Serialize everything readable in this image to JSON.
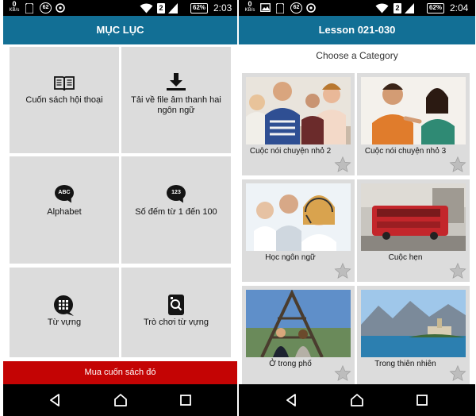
{
  "left": {
    "status": {
      "kb_value": "0",
      "kb_unit": "KB/s",
      "notif_count": "62",
      "sim": "2",
      "battery": "62%",
      "time": "2:03"
    },
    "title": "MỤC LỤC",
    "menu": [
      {
        "label": "Cuốn sách hội thoại",
        "icon": "book-icon"
      },
      {
        "label": "Tải về file âm thanh hai ngôn ngữ",
        "icon": "download-icon"
      },
      {
        "label": "Alphabet",
        "icon": "abc-bubble-icon",
        "icon_text": "ABC"
      },
      {
        "label": "Số đếm từ 1 đến 100",
        "icon": "numbers-bubble-icon",
        "icon_text": "123"
      },
      {
        "label": "Từ vựng",
        "icon": "vocabulary-grid-icon"
      },
      {
        "label": "Trò chơi từ vựng",
        "icon": "game-card-icon"
      }
    ],
    "buy_label": "Mua cuốn sách đó"
  },
  "right": {
    "status": {
      "kb_value": "0",
      "kb_unit": "KB/s",
      "notif_count": "62",
      "sim": "2",
      "battery": "62%",
      "time": "2:04"
    },
    "title": "Lesson 021-030",
    "subtitle": "Choose a Category",
    "categories": [
      {
        "label": "Cuộc nói chuyện nhỏ 2",
        "image": "group-conversation-photo"
      },
      {
        "label": "Cuộc nói chuyện nhỏ 3",
        "image": "couple-conversation-photo"
      },
      {
        "label": "Học ngôn ngữ",
        "image": "headset-learners-photo"
      },
      {
        "label": "Cuộc hẹn",
        "image": "red-bus-photo"
      },
      {
        "label": "Ở trong phố",
        "image": "eiffel-tower-photo"
      },
      {
        "label": "Trong thiên nhiên",
        "image": "lake-town-photo"
      }
    ]
  },
  "icons": {
    "nav": [
      "back-icon",
      "home-icon",
      "recents-icon"
    ],
    "status": [
      "wifi-icon",
      "signal-icon",
      "battery-icon"
    ],
    "favorite": "star-icon"
  },
  "colors": {
    "appbar": "#126f95",
    "buy_button": "#c40404",
    "tile": "#dcdcdc",
    "status_bar": "#000000"
  }
}
